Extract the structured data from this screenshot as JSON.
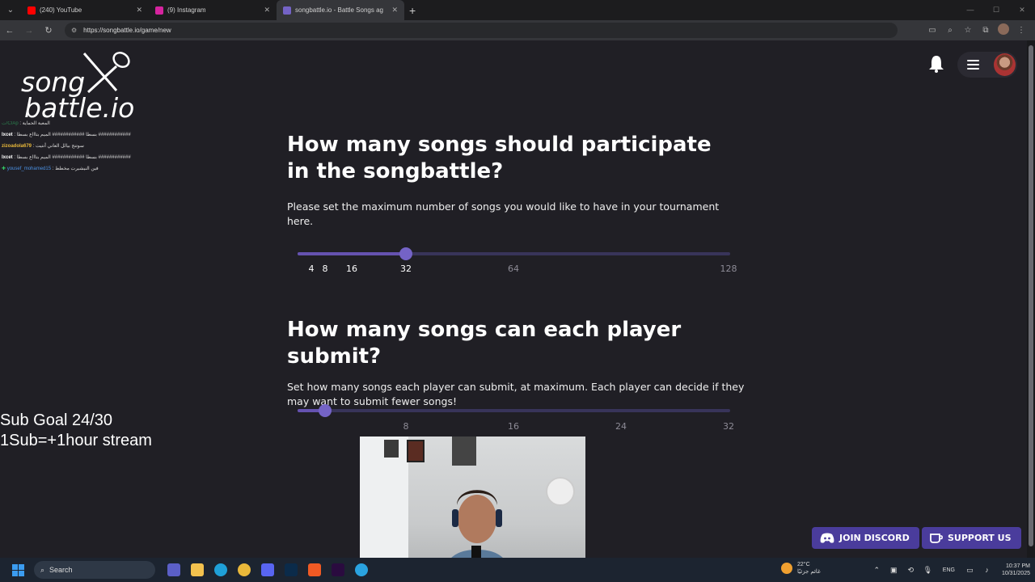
{
  "browser": {
    "tabs": [
      {
        "title": "(240) YouTube",
        "color": "#ff0000",
        "active": false
      },
      {
        "title": "(9) Instagram",
        "color": "#d6249f",
        "active": false
      },
      {
        "title": "songbattle.io - Battle Songs ag",
        "color": "#7463c6",
        "active": true
      }
    ],
    "url": "https://songbattle.io/game/new"
  },
  "logo": {
    "line1": "song",
    "line2": "battle.io"
  },
  "chat": [
    {
      "user": "ت/CIAp",
      "text": "المعبة الحماية",
      "user_style": "c0"
    },
    {
      "user": "lxcet",
      "text": "بسطا ############ الميم بتاااع بسطا ############",
      "user_style": "name-w"
    },
    {
      "user": "zizoadola679",
      "text": "سوتنج بيالل العاني أنتيت",
      "user_style": "name-y"
    },
    {
      "user": "lxcet",
      "text": "بسطا ############ الميم بتاااع بسطا ############",
      "user_style": "name-w"
    },
    {
      "user": "yousef_mohamed15",
      "text": "فين النيشيرت مخطط",
      "user_style": "name-b"
    }
  ],
  "q1": {
    "title": "How many songs should participate in the songbattle?",
    "desc": "Please set the maximum number of songs you would like to have in your tournament here.",
    "value": 32,
    "max": 128,
    "ticks": [
      "4",
      "8",
      "16",
      "32",
      "64",
      "128"
    ]
  },
  "q2": {
    "title": "How many songs can each player submit?",
    "desc": "Set how many songs each player can submit, at maximum. Each player can decide if they may want to submit fewer songs!",
    "value": 2,
    "max": 32,
    "ticks": [
      "8",
      "16",
      "24",
      "32"
    ]
  },
  "overlay": {
    "line1": "Sub Goal 24/30",
    "line2": "1Sub=+1hour stream"
  },
  "buttons": {
    "discord": "JOIN DISCORD",
    "support": "SUPPORT US"
  },
  "taskbar": {
    "search": "Search",
    "temp": "22°C",
    "weather_text": "غائم جزئيًا",
    "lang": "ENG",
    "time": "10:37 PM",
    "date": "10/31/2025"
  },
  "colors": {
    "accent": "#6552b0",
    "button": "#4a3c9c",
    "page_bg": "#201f25"
  }
}
